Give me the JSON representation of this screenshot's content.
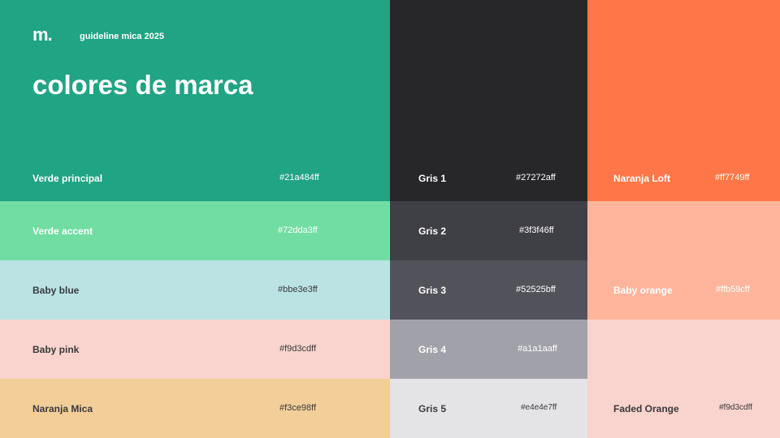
{
  "header": {
    "logo": "m.",
    "subtitle": "guideline mica 2025",
    "title": "colores de marca"
  },
  "columns": [
    {
      "swatches": [
        {
          "name": "Verde principal",
          "hex": "#21a484ff",
          "color": "#21a484"
        },
        {
          "name": "Verde accent",
          "hex": "#72dda3ff",
          "color": "#72dda3"
        },
        {
          "name": "Baby blue",
          "hex": "#bbe3e3ff",
          "color": "#bbe3e3"
        },
        {
          "name": "Baby pink",
          "hex": "#f9d3cdff",
          "color": "#f9d3cd"
        },
        {
          "name": "Naranja Mica",
          "hex": "#f3ce98ff",
          "color": "#f3ce98"
        }
      ]
    },
    {
      "swatches": [
        {
          "name": "Gris 1",
          "hex": "#27272aff",
          "color": "#27272a"
        },
        {
          "name": "Gris 2",
          "hex": "#3f3f46ff",
          "color": "#3f3f46"
        },
        {
          "name": "Gris 3",
          "hex": "#52525bff",
          "color": "#52525b"
        },
        {
          "name": "Gris 4",
          "hex": "#a1a1aaff",
          "color": "#a1a1aa"
        },
        {
          "name": "Gris 5",
          "hex": "#e4e4e7ff",
          "color": "#e4e4e7"
        }
      ]
    },
    {
      "swatches": [
        {
          "name": "Naranja Loft",
          "hex": "#ff7749ff",
          "color": "#ff7749"
        },
        {
          "name": "Baby orange",
          "hex": "#ffb59cff",
          "color": "#ffb59c"
        },
        {
          "name": "Faded Orange",
          "hex": "#f9d3cdff",
          "color": "#f9d3cd"
        }
      ]
    }
  ]
}
